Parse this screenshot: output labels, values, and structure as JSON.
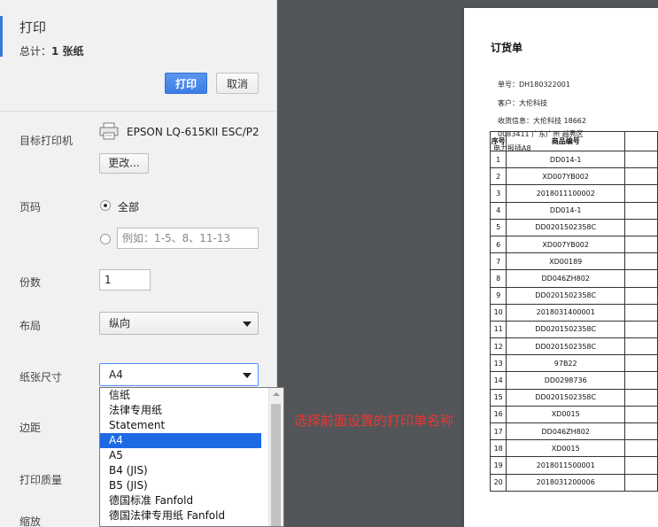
{
  "dialog": {
    "title": "打印",
    "total_prefix": "总计：",
    "total_value": "1 张纸",
    "print_button": "打印",
    "cancel_button": "取消"
  },
  "destination": {
    "label": "目标打印机",
    "printer_name": "EPSON LQ-615KII ESC/P2",
    "change_button": "更改..."
  },
  "pages": {
    "label": "页码",
    "all_label": "全部",
    "custom_placeholder": "例如：1-5、8、11-13"
  },
  "copies": {
    "label": "份数",
    "value": "1"
  },
  "layout": {
    "label": "布局",
    "value": "纵向"
  },
  "paper_size": {
    "label": "纸张尺寸",
    "value": "A4",
    "options": [
      "信纸",
      "法律专用纸",
      "Statement",
      "A4",
      "A5",
      "B4 (JIS)",
      "B5 (JIS)",
      "德国标准 Fanfold",
      "德国法律专用纸 Fanfold"
    ],
    "selected_index": 3
  },
  "margins": {
    "label": "边距"
  },
  "quality": {
    "label": "打印质量"
  },
  "scale": {
    "label": "缩放"
  },
  "annotation": "选择前面设置的打印单名称",
  "document": {
    "title": "订货单",
    "order_no": "单号：DH180322001",
    "customer": "客户：大伦科技",
    "shipping": "收货信息：大伦科技 18662",
    "address": "0083411 广东广州 越秀区",
    "note": "电力报插A8",
    "col_index": "序号",
    "col_code": "商品编号",
    "rows": [
      {
        "idx": "1",
        "code": "DD014-1"
      },
      {
        "idx": "2",
        "code": "XD007YB002"
      },
      {
        "idx": "3",
        "code": "2018011100002"
      },
      {
        "idx": "4",
        "code": "DD014-1"
      },
      {
        "idx": "5",
        "code": "DD0201502358C"
      },
      {
        "idx": "6",
        "code": "XD007YB002"
      },
      {
        "idx": "7",
        "code": "XD00189"
      },
      {
        "idx": "8",
        "code": "DD046ZH802"
      },
      {
        "idx": "9",
        "code": "DD0201502358C"
      },
      {
        "idx": "10",
        "code": "2018031400001"
      },
      {
        "idx": "11",
        "code": "DD0201502358C"
      },
      {
        "idx": "12",
        "code": "DD0201502358C"
      },
      {
        "idx": "13",
        "code": "97B22"
      },
      {
        "idx": "14",
        "code": "DD0298736"
      },
      {
        "idx": "15",
        "code": "DD0201502358C"
      },
      {
        "idx": "16",
        "code": "XD0015"
      },
      {
        "idx": "17",
        "code": "DD046ZH802"
      },
      {
        "idx": "18",
        "code": "XD0015"
      },
      {
        "idx": "19",
        "code": "2018011500001"
      },
      {
        "idx": "20",
        "code": "2018031200006"
      }
    ]
  },
  "colors": {
    "accent": "#3c78d8",
    "selected_option": "#1e6ae6",
    "annotation": "#e53935"
  }
}
